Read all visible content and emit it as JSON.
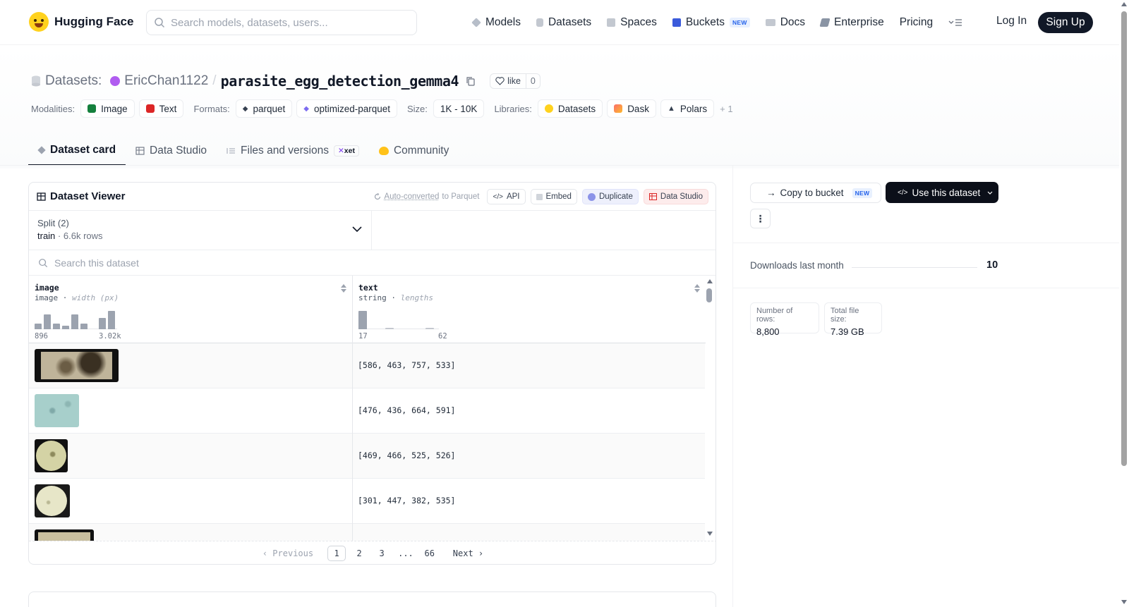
{
  "nav": {
    "brand": "Hugging Face",
    "search_placeholder": "Search models, datasets, users...",
    "links": [
      "Models",
      "Datasets",
      "Spaces",
      "Buckets",
      "Docs",
      "Enterprise",
      "Pricing"
    ],
    "buckets_badge": "NEW",
    "login": "Log In",
    "signup": "Sign Up"
  },
  "repo": {
    "type_label": "Datasets:",
    "owner": "EricChan1122",
    "separator": "/",
    "name": "parasite_egg_detection_gemma4",
    "like_label": "like",
    "like_count": "0"
  },
  "meta": {
    "modalities_label": "Modalities:",
    "modalities": [
      "Image",
      "Text"
    ],
    "formats_label": "Formats:",
    "formats": [
      "parquet",
      "optimized-parquet"
    ],
    "size_label": "Size:",
    "size": "1K - 10K",
    "libraries_label": "Libraries:",
    "libraries": [
      "Datasets",
      "Dask",
      "Polars"
    ],
    "libraries_more": "+ 1"
  },
  "tabs": [
    "Dataset card",
    "Data Studio",
    "Files and versions",
    "Community"
  ],
  "tabs_xet": "xet",
  "viewer": {
    "title": "Dataset Viewer",
    "auto_converted": "Auto-converted",
    "to_parquet": "to Parquet",
    "api": "API",
    "embed": "Embed",
    "duplicate": "Duplicate",
    "data_studio": "Data Studio",
    "split_label": "Split (2)",
    "split_value": "train",
    "split_rows": "6.6k rows",
    "search_placeholder": "Search this dataset",
    "columns": [
      {
        "name": "image",
        "type": "image",
        "stat": "width (px)",
        "min": "896",
        "max": "3.02k"
      },
      {
        "name": "text",
        "type": "string",
        "stat": "lengths",
        "min": "17",
        "max": "62"
      }
    ],
    "rows": [
      "[586, 463, 757, 533]",
      "[476, 436, 664, 591]",
      "[469, 466, 525, 526]",
      "[301, 447, 382, 535]",
      ""
    ],
    "pager": {
      "prev": "Previous",
      "pages": [
        "1",
        "2",
        "3",
        "...",
        "66"
      ],
      "next": "Next"
    }
  },
  "chart_data": [
    {
      "type": "bar",
      "title": "",
      "values": [
        0.3,
        0.8,
        0.3,
        0.2,
        0.8,
        0.3,
        0,
        0.6,
        1.0
      ]
    },
    {
      "type": "bar",
      "title": "",
      "values": [
        1.0,
        0,
        0.05,
        0,
        0,
        0.05
      ]
    }
  ],
  "sidebar": {
    "copy_to_bucket": "Copy to bucket",
    "copy_badge": "NEW",
    "use_dataset": "Use this dataset",
    "downloads_label": "Downloads last month",
    "downloads_value": "10",
    "rows_label": "Number of rows:",
    "rows_value": "8,800",
    "size_label": "Total file size:",
    "size_value": "7.39 GB"
  }
}
